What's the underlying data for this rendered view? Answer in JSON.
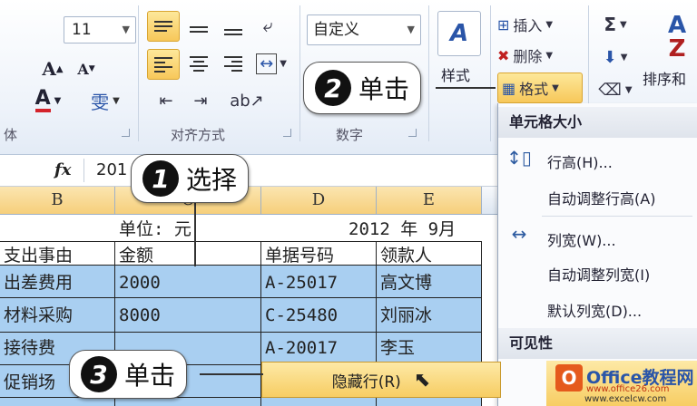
{
  "ribbon": {
    "font_size": "11",
    "number_format": "自定义",
    "groups": {
      "font_label": "体",
      "align_label": "对齐方式",
      "number_label": "数字"
    },
    "style_label": "样式",
    "cells_buttons": {
      "insert": "插入",
      "delete": "删除",
      "format": "格式"
    },
    "sort_label": "排序和"
  },
  "formula_bar": {
    "fx": "fx",
    "value": "201"
  },
  "sheet": {
    "columns": [
      "B",
      "C",
      "D",
      "E"
    ],
    "unit_row": {
      "unit": "单位: 元",
      "date": "2012 年 9月"
    },
    "headers": [
      "支出事由",
      "金额",
      "单据号码",
      "领款人"
    ],
    "rows": [
      [
        "出差费用",
        "2000",
        "A-25017",
        "高文博"
      ],
      [
        "材料采购",
        "8000",
        "C-25480",
        "刘丽冰"
      ],
      [
        "接待费",
        "",
        "A-20017",
        "李玉"
      ],
      [
        "促销场",
        "",
        "",
        ""
      ]
    ]
  },
  "menu": {
    "section1": "单元格大小",
    "items": [
      "行高(H)...",
      "自动调整行高(A)",
      "列宽(W)...",
      "自动调整列宽(I)",
      "默认列宽(D)..."
    ],
    "section2": "可见性"
  },
  "hide_row": "隐藏行(R)",
  "callouts": {
    "c1": {
      "num": "1",
      "text": "选择"
    },
    "c2": {
      "num": "2",
      "text": "单击"
    },
    "c3": {
      "num": "3",
      "text": "单击"
    }
  },
  "watermark": {
    "brand": "Office教程网",
    "url": "www.office26.com",
    "url2": "www.excelcw.com"
  }
}
